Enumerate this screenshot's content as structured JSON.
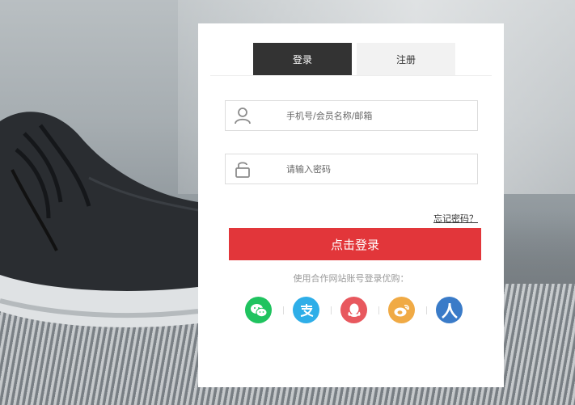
{
  "tabs": {
    "login": "登录",
    "register": "注册"
  },
  "form": {
    "username_placeholder": "手机号/会员名称/邮箱",
    "password_placeholder": "请输入密码",
    "forgot_label": "忘记密码？",
    "submit_label": "点击登录"
  },
  "partner": {
    "prompt": "使用合作网站账号登录优购：",
    "providers": [
      {
        "icon": "wechat-icon",
        "color": "#1fc35f"
      },
      {
        "icon": "alipay-icon",
        "color": "#2eaee8"
      },
      {
        "icon": "qq-icon",
        "color": "#e8585e"
      },
      {
        "icon": "weibo-icon",
        "color": "#f0aa45"
      },
      {
        "icon": "renren-icon",
        "color": "#3a7bc8"
      }
    ]
  },
  "colors": {
    "accent": "#e2363a",
    "active_tab": "#333333",
    "inactive_tab": "#f2f2f2"
  }
}
